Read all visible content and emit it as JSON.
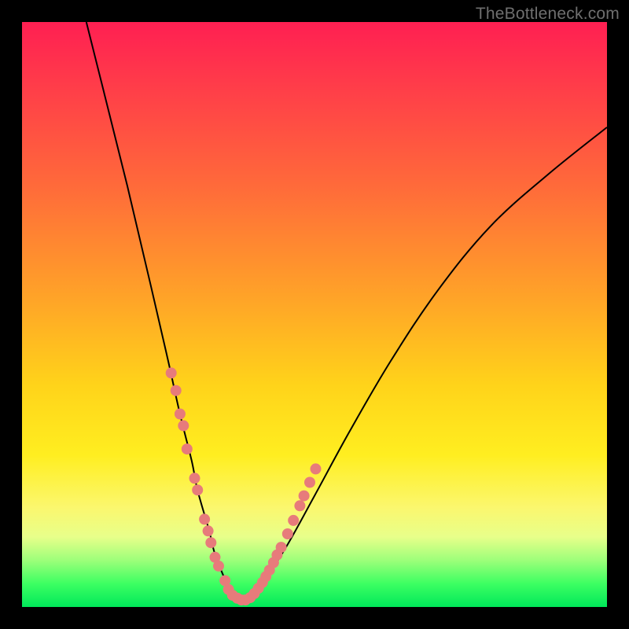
{
  "watermark": "TheBottleneck.com",
  "colors": {
    "frame": "#000000",
    "curve": "#000000",
    "marker_fill": "#e77b7b",
    "marker_stroke": "#d46a6a"
  },
  "chart_data": {
    "type": "line",
    "title": "",
    "xlabel": "",
    "ylabel": "",
    "xlim": [
      0,
      100
    ],
    "ylim": [
      0,
      100
    ],
    "grid": false,
    "legend": null,
    "note": "Axes are unlabeled in the image; x and y are in percent of the plotting area (0 = left/bottom, 100 = right/top). Curve values are read visually to ±3%.",
    "series": [
      {
        "name": "bottleneck-curve",
        "x": [
          11,
          14,
          18,
          22,
          25,
          27,
          29,
          30,
          32,
          33,
          35,
          36,
          38,
          39,
          41,
          45,
          50,
          56,
          63,
          71,
          80,
          90,
          100
        ],
        "y": [
          100,
          88,
          72,
          55,
          42,
          33,
          25,
          20,
          13,
          9,
          4,
          2,
          1,
          2,
          4,
          10,
          19,
          30,
          42,
          54,
          65,
          74,
          82
        ]
      }
    ],
    "markers": {
      "name": "highlighted-points",
      "note": "Salmon dots clustered around the valley of the curve, estimated visually.",
      "points": [
        {
          "x": 25.5,
          "y": 40
        },
        {
          "x": 26.3,
          "y": 37
        },
        {
          "x": 27.0,
          "y": 33
        },
        {
          "x": 27.6,
          "y": 31
        },
        {
          "x": 28.2,
          "y": 27
        },
        {
          "x": 29.5,
          "y": 22
        },
        {
          "x": 30.0,
          "y": 20
        },
        {
          "x": 31.2,
          "y": 15
        },
        {
          "x": 31.8,
          "y": 13
        },
        {
          "x": 32.3,
          "y": 11
        },
        {
          "x": 33.0,
          "y": 8.5
        },
        {
          "x": 33.6,
          "y": 7
        },
        {
          "x": 34.7,
          "y": 4.5
        },
        {
          "x": 35.3,
          "y": 3
        },
        {
          "x": 36.0,
          "y": 2
        },
        {
          "x": 36.8,
          "y": 1.5
        },
        {
          "x": 37.5,
          "y": 1.2
        },
        {
          "x": 38.2,
          "y": 1.2
        },
        {
          "x": 39.0,
          "y": 1.6
        },
        {
          "x": 39.7,
          "y": 2.3
        },
        {
          "x": 40.4,
          "y": 3.2
        },
        {
          "x": 41.1,
          "y": 4.2
        },
        {
          "x": 41.7,
          "y": 5.2
        },
        {
          "x": 42.3,
          "y": 6.3
        },
        {
          "x": 43.0,
          "y": 7.6
        },
        {
          "x": 43.6,
          "y": 8.9
        },
        {
          "x": 44.3,
          "y": 10.2
        },
        {
          "x": 45.4,
          "y": 12.5
        },
        {
          "x": 46.4,
          "y": 14.8
        },
        {
          "x": 47.5,
          "y": 17.3
        },
        {
          "x": 48.2,
          "y": 19.0
        },
        {
          "x": 49.2,
          "y": 21.3
        },
        {
          "x": 50.2,
          "y": 23.6
        }
      ]
    }
  }
}
